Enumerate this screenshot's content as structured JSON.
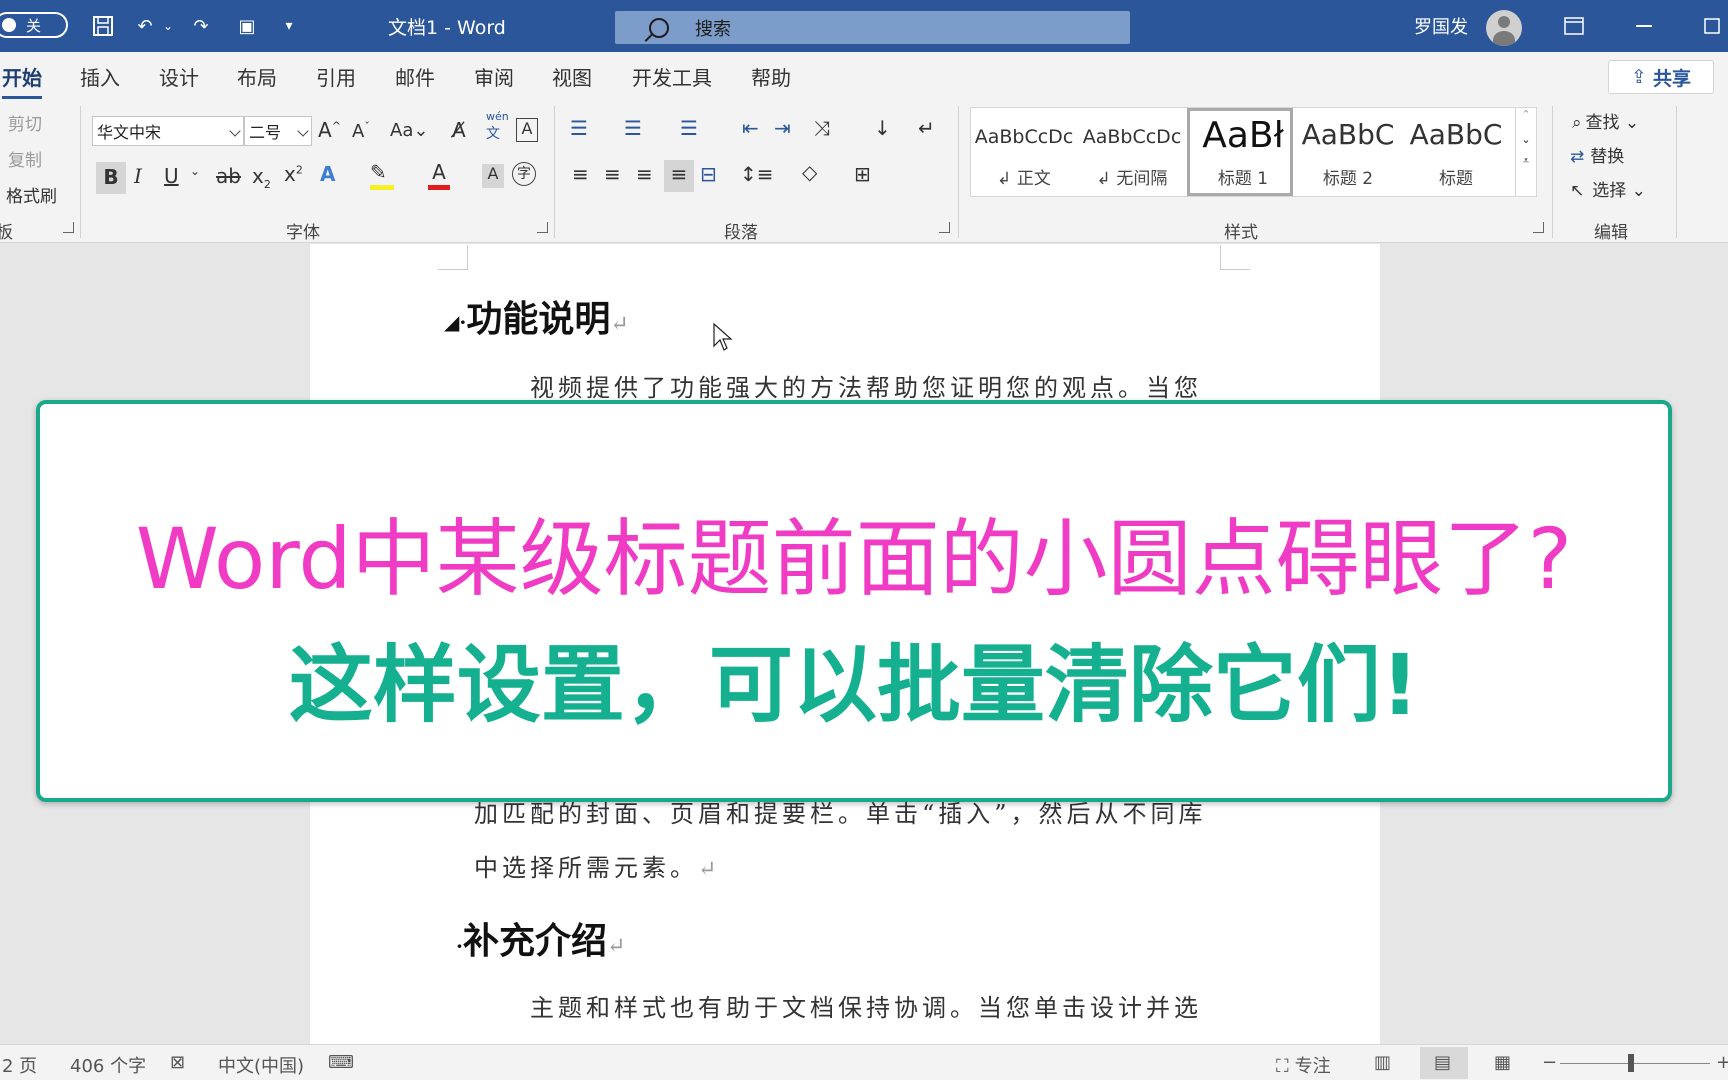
{
  "window": {
    "autosave_label": "关",
    "doc_title": "文档1  -  Word",
    "search_placeholder": "搜索",
    "user_name": "罗国发"
  },
  "ribbon_tabs": [
    "开始",
    "插入",
    "设计",
    "布局",
    "引用",
    "邮件",
    "审阅",
    "视图",
    "开发工具",
    "帮助"
  ],
  "share_label": "共享",
  "clipboard": {
    "cut": "剪切",
    "copy": "复制",
    "format_painter": "格式刷",
    "group_label": "板"
  },
  "font": {
    "font_name": "华文中宋",
    "font_size": "二号",
    "case_label": "Aa",
    "phonetic_label": "wén",
    "group_label": "字体"
  },
  "paragraph": {
    "group_label": "段落"
  },
  "styles": {
    "items": [
      {
        "sample": "AaBbCcDc",
        "name": "↲ 正文"
      },
      {
        "sample": "AaBbCcDc",
        "name": "↲ 无间隔"
      },
      {
        "sample": "AaBł",
        "name": "标题 1"
      },
      {
        "sample": "AaBbC",
        "name": "标题 2"
      },
      {
        "sample": "AaBbC",
        "name": "标题"
      }
    ],
    "group_label": "样式"
  },
  "editing": {
    "find": "查找",
    "replace": "替换",
    "select": "选择",
    "group_label": "编辑"
  },
  "document": {
    "heading1": "功能说明",
    "para1": "视频提供了功能强大的方法帮助您证明您的观点。当您",
    "para2_line1": "加匹配的封面、页眉和提要栏。单击“插入”，然后从不同库",
    "para2_line2": "中选择所需元素。",
    "heading2": "补充介绍",
    "para3": "主题和样式也有助于文档保持协调。当您单击设计并选"
  },
  "banner": {
    "line1": "Word中某级标题前面的小圆点碍眼了?",
    "line2": "这样设置，可以批量清除它们!"
  },
  "status": {
    "page": "2 页",
    "word_count": "406 个字",
    "language": "中文(中国)",
    "focus": "专注"
  },
  "colors": {
    "title_bar": "#2b579a",
    "banner_border": "#1aa88a",
    "banner_line1": "#f03cc4",
    "banner_line2": "#15b08f"
  }
}
